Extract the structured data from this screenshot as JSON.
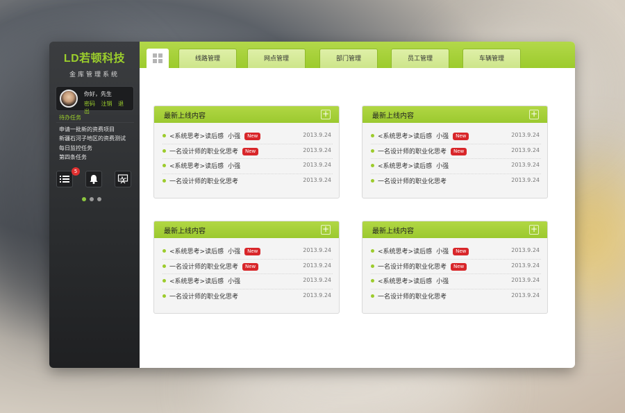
{
  "app": {
    "logo": "LD若顿科技",
    "subtitle": "金库管理系统"
  },
  "user": {
    "greeting": "你好，先生",
    "links": [
      "密码",
      "注销",
      "退出"
    ]
  },
  "todo": {
    "title": "待办任务",
    "items": [
      "申请一批新的资费项目",
      "新疆石河子地区的资费测试",
      "每日监控任务",
      "第四条任务"
    ]
  },
  "tools": {
    "list_badge": "5",
    "icons": [
      "list-icon",
      "bell-icon",
      "monitor-icon"
    ]
  },
  "nav": {
    "home_icon": "grid-icon",
    "tabs": [
      "线路管理",
      "网点管理",
      "部门管理",
      "员工管理",
      "车辆管理"
    ]
  },
  "panels": [
    {
      "title": "最新上线内容",
      "rows": [
        {
          "title": "<系统思考>读后感",
          "author": "小强",
          "badge": "New",
          "date": "2013.9.24"
        },
        {
          "title": "一名设计师的职业化思考",
          "author": "",
          "badge": "New",
          "date": "2013.9.24"
        },
        {
          "title": "<系统思考>读后感",
          "author": "小强",
          "badge": "",
          "date": "2013.9.24"
        },
        {
          "title": "一名设计师的职业化思考",
          "author": "",
          "badge": "",
          "date": "2013.9.24"
        }
      ]
    },
    {
      "title": "最新上线内容",
      "rows": [
        {
          "title": "<系统思考>读后感",
          "author": "小强",
          "badge": "New",
          "date": "2013.9.24"
        },
        {
          "title": "一名设计师的职业化思考",
          "author": "",
          "badge": "New",
          "date": "2013.9.24"
        },
        {
          "title": "<系统思考>读后感",
          "author": "小强",
          "badge": "",
          "date": "2013.9.24"
        },
        {
          "title": "一名设计师的职业化思考",
          "author": "",
          "badge": "",
          "date": "2013.9.24"
        }
      ]
    },
    {
      "title": "最新上线内容",
      "rows": [
        {
          "title": "<系统思考>读后感",
          "author": "小强",
          "badge": "New",
          "date": "2013.9.24"
        },
        {
          "title": "一名设计师的职业化思考",
          "author": "",
          "badge": "New",
          "date": "2013.9.24"
        },
        {
          "title": "<系统思考>读后感",
          "author": "小强",
          "badge": "",
          "date": "2013.9.24"
        },
        {
          "title": "一名设计师的职业化思考",
          "author": "",
          "badge": "",
          "date": "2013.9.24"
        }
      ]
    },
    {
      "title": "最新上线内容",
      "rows": [
        {
          "title": "<系统思考>读后感",
          "author": "小强",
          "badge": "New",
          "date": "2013.9.24"
        },
        {
          "title": "一名设计师的职业化思考",
          "author": "",
          "badge": "New",
          "date": "2013.9.24"
        },
        {
          "title": "<系统思考>读后感",
          "author": "小强",
          "badge": "",
          "date": "2013.9.24"
        },
        {
          "title": "一名设计师的职业化思考",
          "author": "",
          "badge": "",
          "date": "2013.9.24"
        }
      ]
    }
  ],
  "colors": {
    "accent": "#9ccb2c",
    "badge": "#d8262a",
    "sidebar": "#2a2c2e"
  }
}
